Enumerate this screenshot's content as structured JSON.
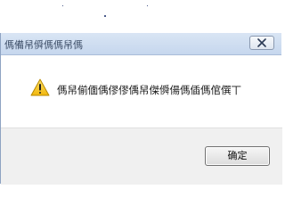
{
  "dialog": {
    "title": "傌備帠僢傌傌帠傌",
    "message": "傌帠偂偭偊僇僇偊帠傑僢偒傌偛傌倌僎丅",
    "ok_label": "确定",
    "icon": "warning-icon",
    "close_icon": "close-icon"
  },
  "colors": {
    "titlebar_top": "#d9e5f4",
    "titlebar_bottom": "#c6d7ee",
    "footer_bg": "#f0f0f0",
    "warning_yellow": "#f5c21b"
  }
}
